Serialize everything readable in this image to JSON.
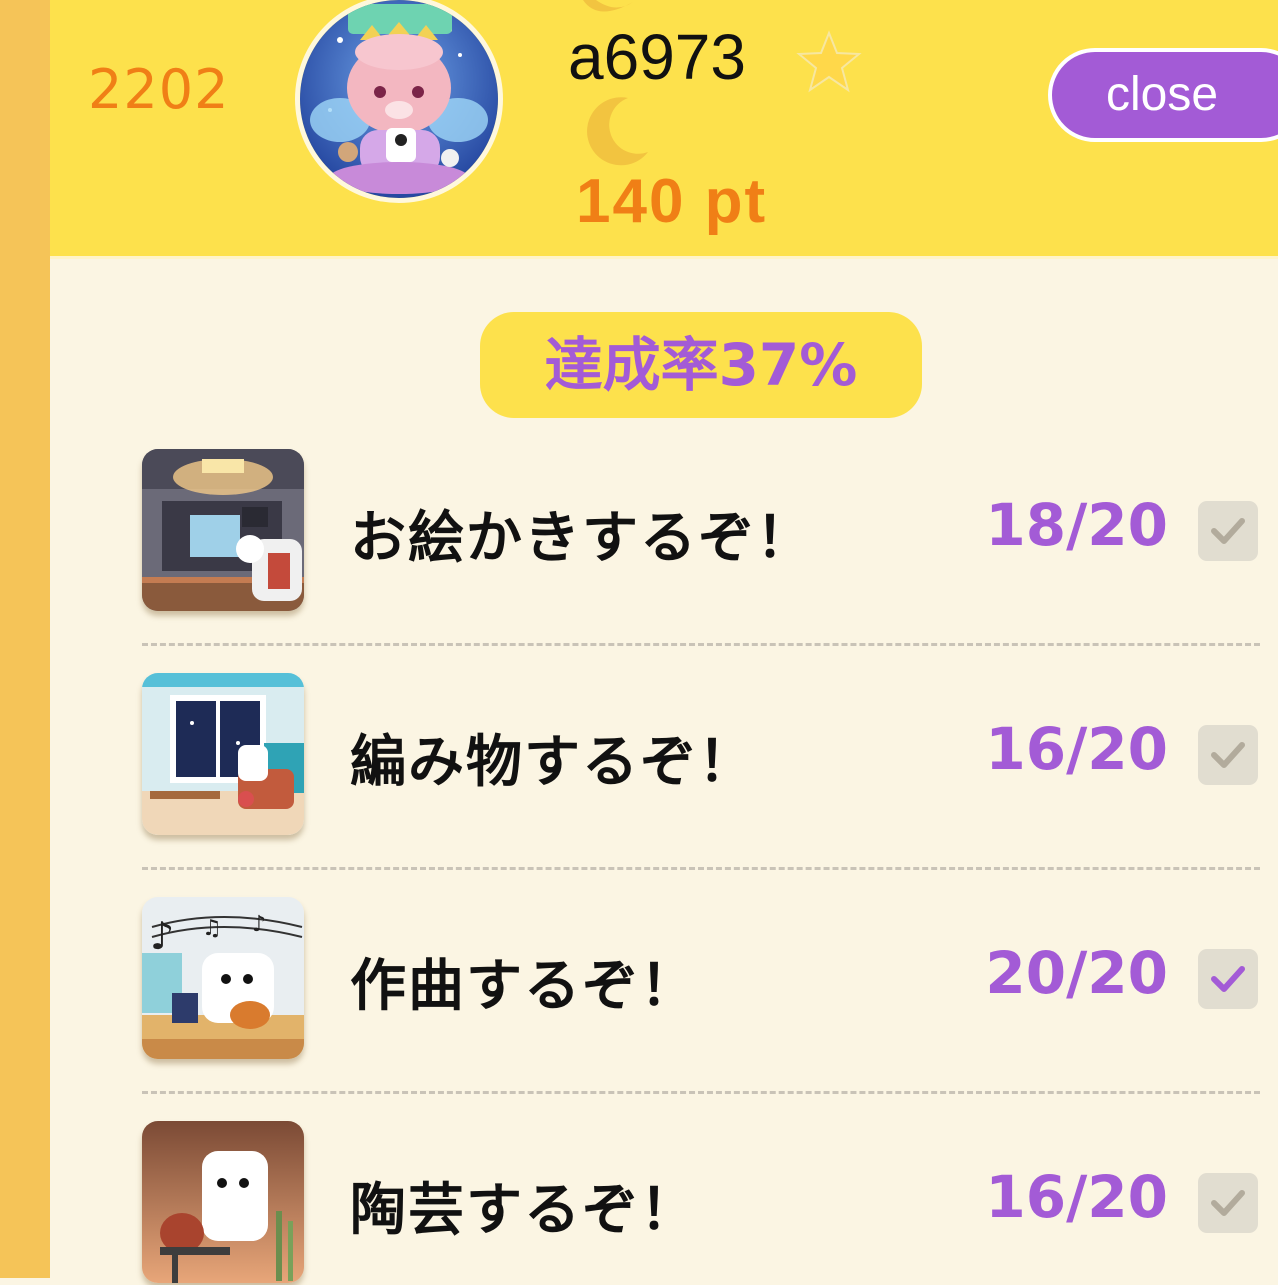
{
  "header": {
    "rank": "2202",
    "username": "a6973",
    "points": "140 pt",
    "close_label": "close"
  },
  "achievement": {
    "rate_label": "達成率37%"
  },
  "missions": [
    {
      "title": "お絵かきするぞ！",
      "progress": "18/20",
      "completed": false
    },
    {
      "title": "編み物するぞ！",
      "progress": "16/20",
      "completed": false
    },
    {
      "title": "作曲するぞ！",
      "progress": "20/20",
      "completed": true
    },
    {
      "title": "陶芸するぞ！",
      "progress": "16/20",
      "completed": false
    }
  ],
  "colors": {
    "header_bg": "#fde14c",
    "accent_purple": "#a35bd6",
    "accent_orange": "#f07f16",
    "page_bg": "#fbf5e3"
  },
  "icons": {
    "avatar": "avatar-icon",
    "star": "star-icon",
    "moon": "moon-icon",
    "check": "check-icon"
  }
}
